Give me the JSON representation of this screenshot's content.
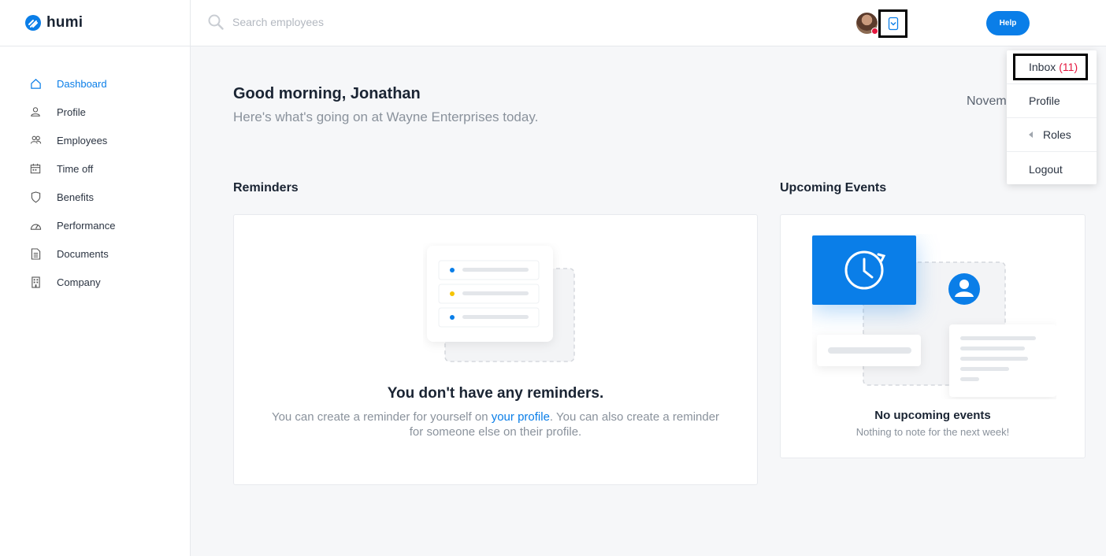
{
  "brand": {
    "name": "humi",
    "color": "#0a7ee8",
    "logo_icon": "humi-logo-icon"
  },
  "sidebar": {
    "items": [
      {
        "label": "Dashboard",
        "icon": "home-icon",
        "active": true
      },
      {
        "label": "Profile",
        "icon": "user-icon"
      },
      {
        "label": "Employees",
        "icon": "users-icon"
      },
      {
        "label": "Time off",
        "icon": "calendar-icon"
      },
      {
        "label": "Benefits",
        "icon": "shield-icon"
      },
      {
        "label": "Performance",
        "icon": "gauge-icon"
      },
      {
        "label": "Documents",
        "icon": "document-icon"
      },
      {
        "label": "Company",
        "icon": "building-icon"
      }
    ]
  },
  "header": {
    "search_placeholder": "Search employees",
    "help_label": "Help"
  },
  "dropdown": {
    "inbox_label": "Inbox",
    "inbox_count": "(11)",
    "profile_label": "Profile",
    "roles_label": "Roles",
    "logout_label": "Logout"
  },
  "main": {
    "greeting": "Good morning, Jonathan",
    "subgreeting": "Here's what's going on at Wayne Enterprises today.",
    "date": "Novem"
  },
  "reminders": {
    "title": "Reminders",
    "empty_title": "You don't have any reminders.",
    "text_before": "You can create a reminder for yourself on ",
    "link": "your profile",
    "text_after": ". You can also create a reminder for someone else on their profile."
  },
  "events": {
    "title": "Upcoming Events",
    "empty_title": "No upcoming events",
    "empty_text": "Nothing to note for the next week!"
  },
  "colors": {
    "accent": "#0a7ee8",
    "alert": "#e4163e",
    "dot_yellow": "#f5c400"
  }
}
